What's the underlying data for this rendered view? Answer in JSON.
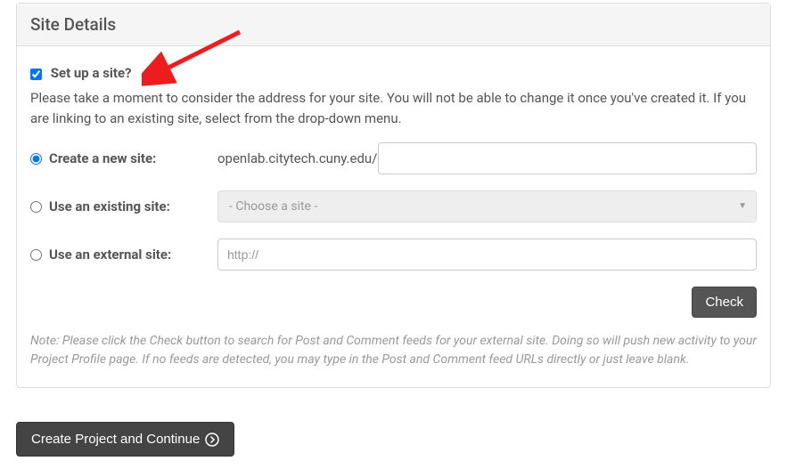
{
  "panel": {
    "title": "Site Details"
  },
  "setup": {
    "checkbox_label": "Set up a site?",
    "checked": true,
    "instructions": "Please take a moment to consider the address for your site. You will not be able to change it once you've created it. If you are linking to an existing site, select from the drop-down menu."
  },
  "options": {
    "create": {
      "label": "Create a new site:",
      "domain_prefix": "openlab.citytech.cuny.edu/",
      "value": ""
    },
    "existing": {
      "label": "Use an existing site:",
      "select_placeholder": "- Choose a site -"
    },
    "external": {
      "label": "Use an external site:",
      "placeholder": "http://"
    }
  },
  "buttons": {
    "check": "Check",
    "submit": "Create Project and Continue"
  },
  "note": "Note: Please click the Check button to search for Post and Comment feeds for your external site. Doing so will push new activity to your Project Profile page. If no feeds are detected, you may type in the Post and Comment feed URLs directly or just leave blank."
}
